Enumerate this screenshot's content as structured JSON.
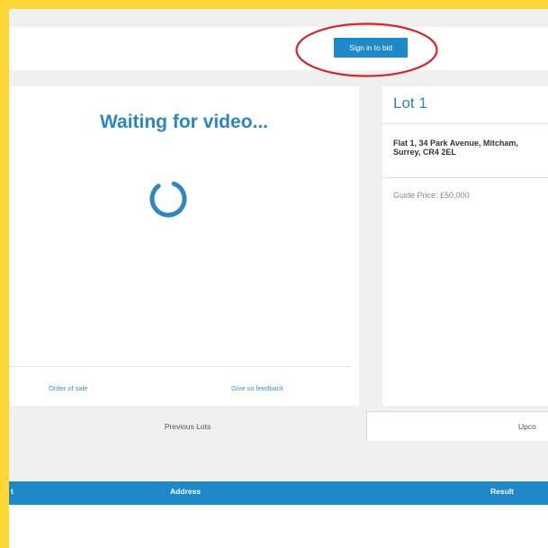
{
  "header": {
    "sign_in_label": "Sign in to bid"
  },
  "video": {
    "status": "Waiting for video...",
    "links": {
      "order_of_sale": "Order of sale",
      "feedback": "Give us feedback"
    }
  },
  "lot": {
    "title": "Lot 1",
    "address_line1": "Flat 1, 34 Park Avenue, Mitcham,",
    "address_line2": "Surrey, CR4 2EL",
    "guide_price": "Guide Price: £50,000"
  },
  "tabs": {
    "previous": "Previous Lots",
    "upcoming": "Upco"
  },
  "table": {
    "columns": {
      "lot_partial": "t",
      "address": "Address",
      "result": "Result"
    }
  },
  "colors": {
    "accent": "#1e88c8",
    "frame": "#fcd835",
    "highlight": "#d8232a"
  }
}
